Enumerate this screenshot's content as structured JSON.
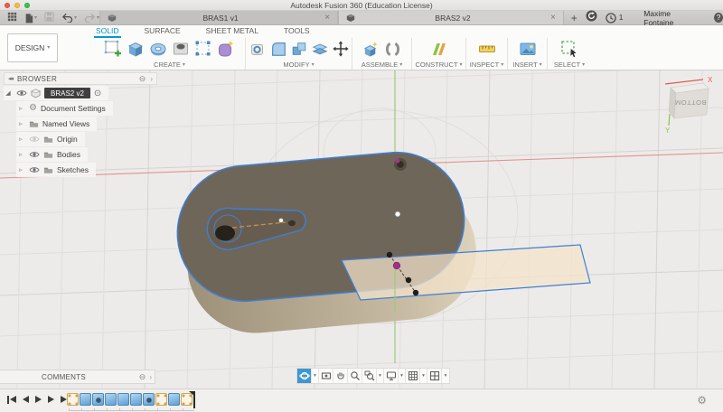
{
  "titlebar": {
    "title": "Autodesk Fusion 360 (Education License)"
  },
  "tabbar": {
    "tabs": [
      {
        "label": "BRAS1 v1"
      },
      {
        "label": "BRAS2 v2"
      }
    ],
    "user_name": "Maxime Fontaine",
    "notification_count": "1"
  },
  "ribbon": {
    "design_button": "DESIGN",
    "tabs": [
      {
        "label": "SOLID"
      },
      {
        "label": "SURFACE"
      },
      {
        "label": "SHEET METAL"
      },
      {
        "label": "TOOLS"
      }
    ],
    "active_tab": "SOLID",
    "groups": [
      {
        "label": "CREATE"
      },
      {
        "label": "MODIFY"
      },
      {
        "label": "ASSEMBLE"
      },
      {
        "label": "CONSTRUCT"
      },
      {
        "label": "INSPECT"
      },
      {
        "label": "INSERT"
      },
      {
        "label": "SELECT"
      }
    ]
  },
  "browser": {
    "title": "BROWSER",
    "root": {
      "label": "BRAS2 v2"
    },
    "items": [
      {
        "label": "Document Settings"
      },
      {
        "label": "Named Views"
      },
      {
        "label": "Origin"
      },
      {
        "label": "Bodies"
      },
      {
        "label": "Sketches"
      }
    ]
  },
  "viewcube": {
    "face": "BOTTOM",
    "axis_x": "X",
    "axis_y": "Y"
  },
  "comments": {
    "title": "COMMENTS"
  },
  "timeline": {
    "features": [
      {
        "type": "sketch"
      },
      {
        "type": "extrude"
      },
      {
        "type": "hole"
      },
      {
        "type": "extrude"
      },
      {
        "type": "extrude"
      },
      {
        "type": "extrude"
      },
      {
        "type": "hole"
      },
      {
        "type": "sketch"
      },
      {
        "type": "extrude"
      },
      {
        "type": "sketch"
      }
    ]
  },
  "icons": {
    "caret": "▾",
    "close": "×",
    "new_tab": "+",
    "help": "?",
    "gear": "⚙",
    "detach": "⊖",
    "panel_arrow": "›",
    "collapse_left": "◂◂",
    "activate": "⊙",
    "expand_root": "◢",
    "expand": "▹"
  },
  "colors": {
    "accent_blue": "#0696d7",
    "selection_blue": "#3e7fd6",
    "axis_red": "#e09390",
    "axis_green": "#9cc87e",
    "body_top": "#6f665a",
    "body_side": "#c3b7a0",
    "plane_fill": "#f4e3ca"
  }
}
